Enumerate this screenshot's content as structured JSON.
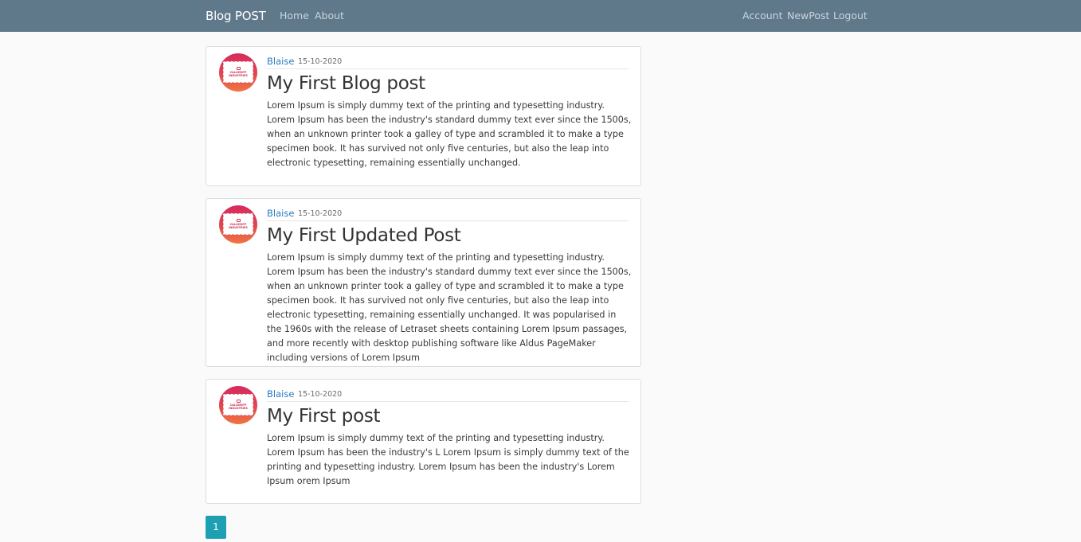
{
  "navbar": {
    "brand": "Blog POST",
    "left_links": [
      "Home",
      "About"
    ],
    "right_links": [
      "Account",
      "NewPost",
      "Logout"
    ]
  },
  "avatar": {
    "label": "CALIGRIPP INDUSTRIES"
  },
  "posts": [
    {
      "author": "Blaise",
      "date": "15-10-2020",
      "title": "My First Blog post",
      "body": "Lorem Ipsum is simply dummy text of the printing and typesetting industry. Lorem Ipsum has been the industry's standard dummy text ever since the 1500s, when an unknown printer took a galley of type and scrambled it to make a type specimen book. It has survived not only five centuries, but also the leap into electronic typesetting, remaining essentially unchanged."
    },
    {
      "author": "Blaise",
      "date": "15-10-2020",
      "title": "My First Updated Post",
      "body": "Lorem Ipsum is simply dummy text of the printing and typesetting industry. Lorem Ipsum has been the industry's standard dummy text ever since the 1500s, when an unknown printer took a galley of type and scrambled it to make a type specimen book. It has survived not only five centuries, but also the leap into electronic typesetting, remaining essentially unchanged. It was popularised in the 1960s with the release of Letraset sheets containing Lorem Ipsum passages, and more recently with desktop publishing software like Aldus PageMaker including versions of Lorem Ipsum"
    },
    {
      "author": "Blaise",
      "date": "15-10-2020",
      "title": "My First post",
      "body": "Lorem Ipsum is simply dummy text of the printing and typesetting industry. Lorem Ipsum has been the industry's L Lorem Ipsum is simply dummy text of the printing and typesetting industry. Lorem Ipsum has been the industry's Lorem Ipsum orem Ipsum"
    }
  ],
  "pagination": {
    "current_page": "1"
  },
  "colors": {
    "navbar": "#5f788a",
    "link": "#2a7bbf",
    "page_button": "#1ea0b3",
    "background": "#fafafa"
  }
}
